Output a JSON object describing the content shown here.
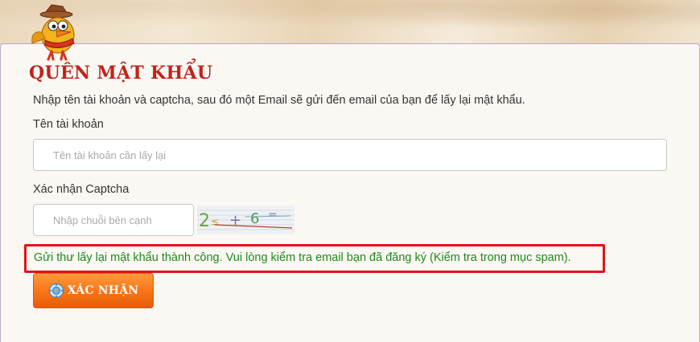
{
  "page": {
    "title": "QUÊN MẬT KHẨU",
    "instructions": "Nhập tên tài khoản và captcha, sau đó một Email sẽ gửi đến email của bạn để lấy lại mật khẩu."
  },
  "form": {
    "account": {
      "label": "Tên tài khoản",
      "placeholder": "Tên tài khoản cần lấy lại",
      "value": ""
    },
    "captcha": {
      "label": "Xác nhận Captcha",
      "placeholder": "Nhập chuỗi bên cạnh",
      "value": "",
      "image_text": "2 + 6 ="
    },
    "submit_label": "XÁC NHẬN"
  },
  "status": {
    "message": "Gửi thư lấy lại mật khẩu thành công. Vui lòng kiểm tra email bạn đã đăng ký (Kiểm tra trong mục spam).",
    "type": "success",
    "color": "#1c8a1c",
    "highlight_color": "#e0141b"
  },
  "colors": {
    "title": "#c1231b",
    "button": "#f97316",
    "panel_border": "#b9a7cf"
  },
  "icons": {
    "mascot": "bird-mascot-icon",
    "button": "gear-badge-icon"
  }
}
